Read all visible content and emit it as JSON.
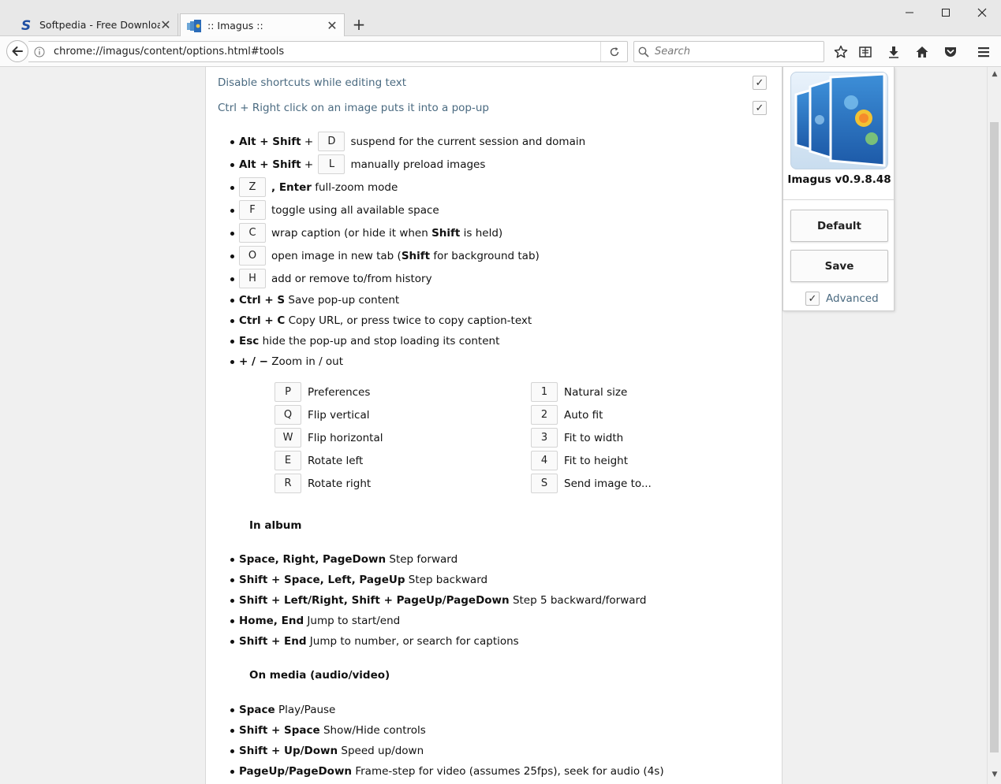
{
  "browser": {
    "tabs": [
      {
        "title": "Softpedia - Free Downloa...",
        "active": false
      },
      {
        "title": ":: Imagus ::",
        "active": true
      }
    ],
    "url": "chrome://imagus/content/options.html#tools",
    "search_placeholder": "Search"
  },
  "options": {
    "disable_shortcuts": "Disable shortcuts while editing text",
    "ctrl_right_click": "Ctrl + Right click on an image puts it into a pop-up"
  },
  "shortcuts": {
    "suspend": {
      "mod": "Alt + Shift",
      "key": "D",
      "desc": "suspend for the current session and domain"
    },
    "preload": {
      "mod": "Alt + Shift",
      "key": "L",
      "desc": "manually preload images"
    },
    "fullzoom": {
      "key": "Z",
      "mod": ", Enter",
      "desc": "full-zoom mode"
    },
    "toggle": {
      "key": "F",
      "desc": "toggle using all available space"
    },
    "wrap": {
      "key": "C",
      "desc_a": "wrap caption (or hide it when ",
      "bold": "Shift",
      "desc_b": " is held)"
    },
    "open": {
      "key": "O",
      "desc_a": "open image in new tab (",
      "bold": "Shift",
      "desc_b": " for background tab)"
    },
    "history": {
      "key": "H",
      "desc": "add or remove to/from history"
    },
    "save": {
      "combo": "Ctrl + S",
      "desc": "Save pop-up content"
    },
    "copy": {
      "combo": "Ctrl + C",
      "desc": "Copy URL, or press twice to copy caption-text"
    },
    "esc": {
      "combo": "Esc",
      "desc": "hide the pop-up and stop loading its content"
    },
    "zoom": {
      "combo": "+ / −",
      "desc": "Zoom in / out"
    }
  },
  "popup_keys": {
    "left": [
      {
        "key": "P",
        "label": "Preferences"
      },
      {
        "key": "Q",
        "label": "Flip vertical"
      },
      {
        "key": "W",
        "label": "Flip horizontal"
      },
      {
        "key": "E",
        "label": "Rotate left"
      },
      {
        "key": "R",
        "label": "Rotate right"
      }
    ],
    "right": [
      {
        "key": "1",
        "label": "Natural size"
      },
      {
        "key": "2",
        "label": "Auto fit"
      },
      {
        "key": "3",
        "label": "Fit to width"
      },
      {
        "key": "4",
        "label": "Fit to height"
      },
      {
        "key": "S",
        "label": "Send image to..."
      }
    ]
  },
  "album": {
    "heading": "In album",
    "items": [
      {
        "combo": "Space, Right, PageDown",
        "desc": "Step forward"
      },
      {
        "combo": "Shift + Space, Left, PageUp",
        "desc": "Step backward"
      },
      {
        "combo": "Shift + Left/Right, Shift + PageUp/PageDown",
        "desc": "Step 5 backward/forward"
      },
      {
        "combo": "Home, End",
        "desc": "Jump to start/end"
      },
      {
        "combo": "Shift + End",
        "desc": "Jump to number, or search for captions"
      }
    ]
  },
  "media": {
    "heading": "On media (audio/video)",
    "items": [
      {
        "combo": "Space",
        "desc": "Play/Pause"
      },
      {
        "combo": "Shift + Space",
        "desc": "Show/Hide controls"
      },
      {
        "combo": "Shift + Up/Down",
        "desc": "Speed up/down"
      },
      {
        "combo": "PageUp/PageDown",
        "desc": "Frame-step for video (assumes 25fps), seek for audio (4s)"
      }
    ]
  },
  "side": {
    "version": "Imagus v0.9.8.48",
    "default_label": "Default",
    "save_label": "Save",
    "advanced_label": "Advanced"
  },
  "colors": {
    "option_text": "#4a6a80",
    "logo_blue": "#2a6bb8"
  }
}
